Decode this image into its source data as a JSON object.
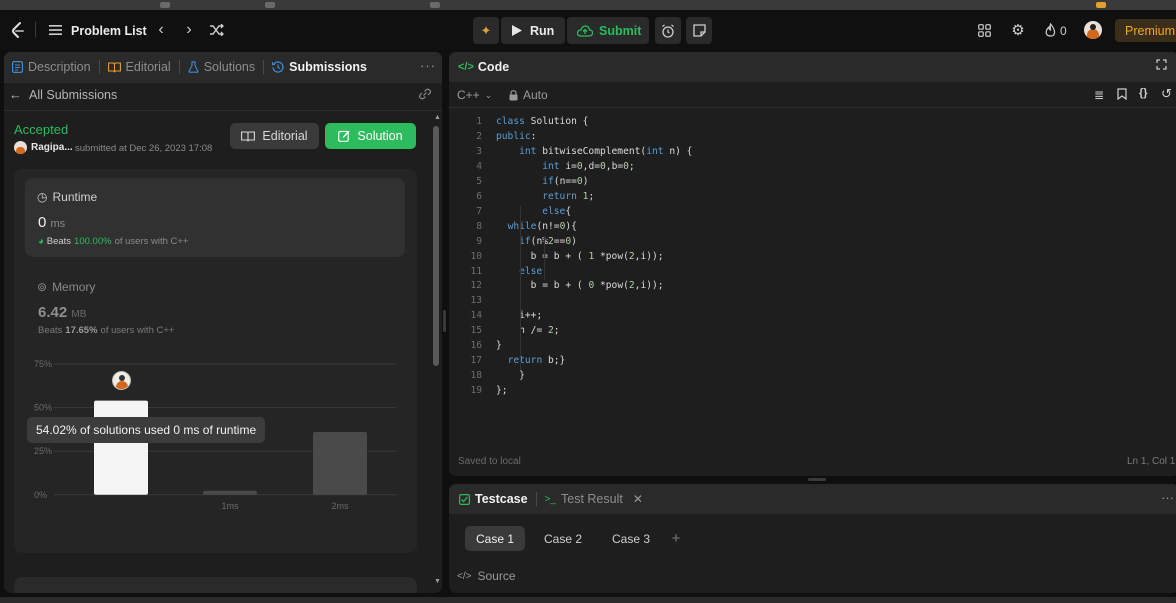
{
  "topbar": {
    "problem_list": "Problem List",
    "run": "Run",
    "submit": "Submit",
    "streak_count": "0",
    "premium": "Premium"
  },
  "left_tabs": {
    "description": "Description",
    "editorial": "Editorial",
    "solutions": "Solutions",
    "submissions": "Submissions"
  },
  "submission": {
    "back_label": "All Submissions",
    "status": "Accepted",
    "user": "Ragipa...",
    "submitted_at": "submitted at Dec 26, 2023 17:08",
    "editorial_button": "Editorial",
    "solution_button": "Solution"
  },
  "runtime": {
    "title": "Runtime",
    "value": "0",
    "unit": "ms",
    "beats_label": "Beats",
    "beats_value": "100.00%",
    "beats_suffix": "of users with C++"
  },
  "memory": {
    "title": "Memory",
    "value": "6.42",
    "unit": "MB",
    "beats_label": "Beats",
    "beats_value": "17.65%",
    "beats_suffix": "of users with C++"
  },
  "tooltip": "54.02% of solutions used 0 ms of runtime",
  "chart_data": {
    "type": "bar",
    "categories": [
      "0ms",
      "1ms",
      "2ms"
    ],
    "category_labels_shown": [
      "",
      "1ms",
      "2ms"
    ],
    "values": [
      54.02,
      2,
      36
    ],
    "highlight_index": 0,
    "yticks": [
      "75%",
      "50%",
      "25%",
      "0%"
    ],
    "ylim": [
      0,
      75
    ],
    "mini_labels": [
      "1ms",
      "2ms"
    ]
  },
  "code_panel": {
    "title": "Code",
    "language": "C++",
    "mode": "Auto",
    "saved": "Saved to local",
    "cursor": "Ln 1, Col 1",
    "lines": [
      "class Solution {",
      "public:",
      "    int bitwiseComplement(int n) {",
      "        int i=0,d=0,b=0;",
      "        if(n==0)",
      "        return 1;",
      "        else{",
      "  while(n!=0){",
      "    if(n%2==0)",
      "      b = b + ( 1 *pow(2,i));",
      "    else",
      "      b = b + ( 0 *pow(2,i));",
      "",
      "    i++;",
      "    n /= 2;",
      "}",
      "  return b;}",
      "    }",
      "};"
    ]
  },
  "testcase": {
    "tab_testcase": "Testcase",
    "tab_result": "Test Result",
    "cases": [
      "Case 1",
      "Case 2",
      "Case 3"
    ],
    "source": "Source"
  },
  "colors": {
    "accent_green": "#2cbb5d",
    "blue": "#3b8bd6",
    "premium": "#f5a623"
  }
}
